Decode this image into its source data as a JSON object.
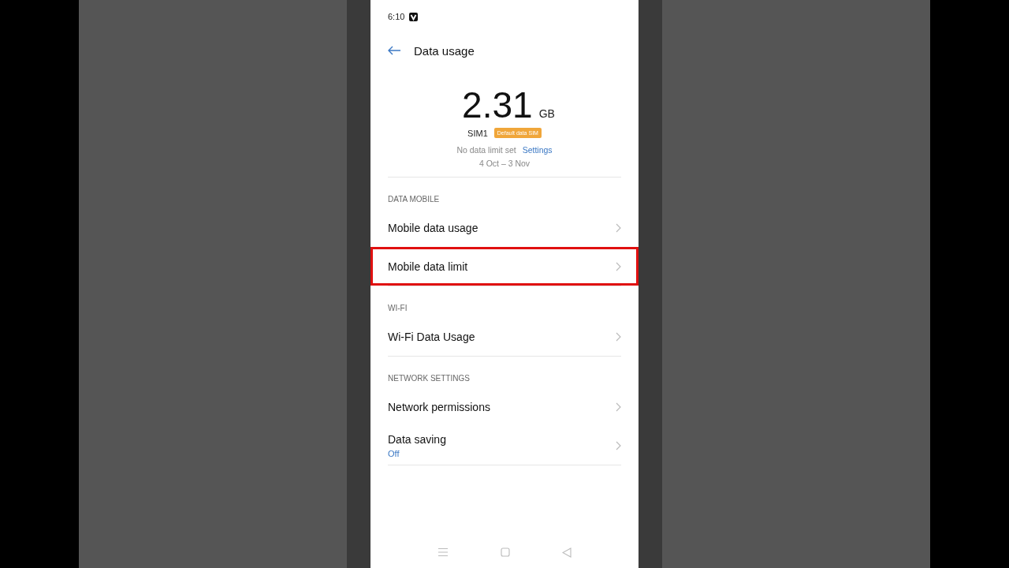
{
  "status_bar": {
    "time": "6:10"
  },
  "header": {
    "title": "Data usage"
  },
  "usage": {
    "amount": "2.31",
    "unit": "GB",
    "sim": "SIM1",
    "sim_badge": "Default data SIM",
    "limit_text": "No data limit set",
    "limit_link": "Settings",
    "period": "4 Oct – 3 Nov"
  },
  "sections": [
    {
      "title": "DATA MOBILE",
      "items": [
        {
          "label": "Mobile data usage",
          "highlighted": false
        },
        {
          "label": "Mobile data limit",
          "highlighted": true
        }
      ]
    },
    {
      "title": "WI-FI",
      "items": [
        {
          "label": "Wi-Fi Data Usage",
          "highlighted": false
        }
      ]
    },
    {
      "title": "NETWORK SETTINGS",
      "items": [
        {
          "label": "Network permissions",
          "highlighted": false
        },
        {
          "label": "Data saving",
          "value": "Off",
          "highlighted": false
        }
      ]
    }
  ]
}
